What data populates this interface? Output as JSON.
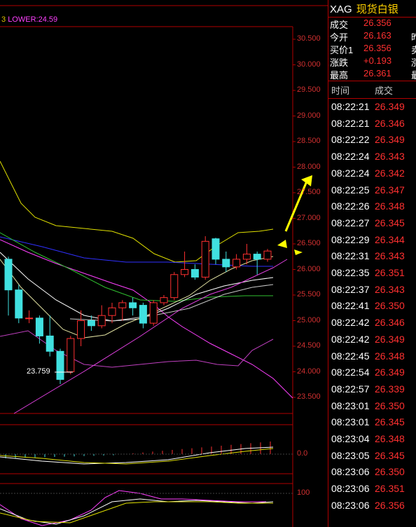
{
  "indicator_label": {
    "cut": "3",
    "text": "LOWER:24.59"
  },
  "price_axis": [
    "30.500",
    "30.000",
    "29.500",
    "29.000",
    "28.500",
    "28.000",
    "27.500",
    "27.000",
    "26.500",
    "26.000",
    "25.500",
    "25.000",
    "24.500",
    "24.000",
    "23.500"
  ],
  "macd_axis": "0.0",
  "kdj_axis": "100",
  "low_label": "23.759",
  "symbol": "XAG",
  "name": "现货白银",
  "quote": [
    {
      "key": "成交",
      "value": "26.356",
      "extra": ""
    },
    {
      "key": "今开",
      "value": "26.163",
      "extra": "昨"
    },
    {
      "key": "买价1",
      "value": "26.356",
      "extra": "卖"
    },
    {
      "key": "涨跌",
      "value": "+0.193",
      "extra": "涨"
    },
    {
      "key": "最高",
      "value": "26.361",
      "extra": "最"
    }
  ],
  "ticks_header": {
    "time": "时间",
    "price": "成交"
  },
  "ticks": [
    {
      "time": "08:22:21",
      "price": "26.349"
    },
    {
      "time": "08:22:21",
      "price": "26.346"
    },
    {
      "time": "08:22:22",
      "price": "26.349"
    },
    {
      "time": "08:22:24",
      "price": "26.343"
    },
    {
      "time": "08:22:24",
      "price": "26.342"
    },
    {
      "time": "08:22:25",
      "price": "26.347"
    },
    {
      "time": "08:22:26",
      "price": "26.348"
    },
    {
      "time": "08:22:27",
      "price": "26.345"
    },
    {
      "time": "08:22:29",
      "price": "26.344"
    },
    {
      "time": "08:22:31",
      "price": "26.343"
    },
    {
      "time": "08:22:35",
      "price": "26.351"
    },
    {
      "time": "08:22:37",
      "price": "26.343"
    },
    {
      "time": "08:22:41",
      "price": "26.350"
    },
    {
      "time": "08:22:42",
      "price": "26.346"
    },
    {
      "time": "08:22:42",
      "price": "26.349"
    },
    {
      "time": "08:22:45",
      "price": "26.348"
    },
    {
      "time": "08:22:54",
      "price": "26.349"
    },
    {
      "time": "08:22:57",
      "price": "26.339"
    },
    {
      "time": "08:23:01",
      "price": "26.350"
    },
    {
      "time": "08:23:01",
      "price": "26.345"
    },
    {
      "time": "08:23:04",
      "price": "26.348"
    },
    {
      "time": "08:23:05",
      "price": "26.345"
    },
    {
      "time": "08:23:06",
      "price": "26.350"
    },
    {
      "time": "08:23:06",
      "price": "26.351"
    },
    {
      "time": "08:23:06",
      "price": "26.356"
    }
  ],
  "candles": [
    {
      "o": 26.2,
      "c": 25.6,
      "h": 26.25,
      "l": 25.1
    },
    {
      "o": 25.6,
      "c": 25.05,
      "h": 25.7,
      "l": 24.95
    },
    {
      "o": 25.05,
      "c": 25.05,
      "h": 25.2,
      "l": 24.95
    },
    {
      "o": 25.05,
      "c": 24.7,
      "h": 25.1,
      "l": 24.55
    },
    {
      "o": 24.7,
      "c": 24.4,
      "h": 25.1,
      "l": 24.3
    },
    {
      "o": 24.4,
      "c": 23.85,
      "h": 24.45,
      "l": 23.76
    },
    {
      "o": 24.0,
      "c": 24.65,
      "h": 24.7,
      "l": 23.95
    },
    {
      "o": 24.65,
      "c": 25.0,
      "h": 25.2,
      "l": 24.5
    },
    {
      "o": 25.0,
      "c": 24.9,
      "h": 25.1,
      "l": 24.8
    },
    {
      "o": 24.9,
      "c": 25.1,
      "h": 25.3,
      "l": 24.85
    },
    {
      "o": 25.1,
      "c": 25.25,
      "h": 25.35,
      "l": 24.95
    },
    {
      "o": 25.25,
      "c": 25.35,
      "h": 25.4,
      "l": 25.0
    },
    {
      "o": 25.35,
      "c": 25.25,
      "h": 25.45,
      "l": 25.1
    },
    {
      "o": 25.3,
      "c": 24.95,
      "h": 25.35,
      "l": 24.85
    },
    {
      "o": 24.95,
      "c": 25.35,
      "h": 25.4,
      "l": 24.9
    },
    {
      "o": 25.35,
      "c": 25.45,
      "h": 25.5,
      "l": 25.3
    },
    {
      "o": 25.45,
      "c": 25.9,
      "h": 25.95,
      "l": 25.4
    },
    {
      "o": 25.9,
      "c": 26.0,
      "h": 26.35,
      "l": 25.85
    },
    {
      "o": 26.0,
      "c": 25.85,
      "h": 26.1,
      "l": 25.8
    },
    {
      "o": 25.85,
      "c": 26.55,
      "h": 26.65,
      "l": 25.8
    },
    {
      "o": 26.6,
      "c": 26.2,
      "h": 26.62,
      "l": 26.1
    },
    {
      "o": 26.2,
      "c": 26.05,
      "h": 26.35,
      "l": 25.95
    },
    {
      "o": 26.05,
      "c": 26.2,
      "h": 26.3,
      "l": 26.0
    },
    {
      "o": 26.2,
      "c": 26.3,
      "h": 26.5,
      "l": 26.1
    },
    {
      "o": 26.3,
      "c": 26.2,
      "h": 26.35,
      "l": 25.9
    },
    {
      "o": 26.2,
      "c": 26.36,
      "h": 26.4,
      "l": 26.15
    }
  ],
  "colors": {
    "up": "#ff3030",
    "down": "#40e0e0",
    "grid": "#b00000",
    "arrow": "#ffff00"
  }
}
